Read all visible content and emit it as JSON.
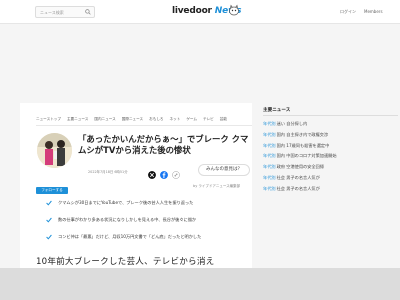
{
  "header": {
    "search_placeholder": "ニュース検索",
    "logo_main": "livedoor",
    "logo_news": "News",
    "login_label": "ログイン",
    "member_label": "Members"
  },
  "category_nav": [
    "ニューストップ",
    "主要ニュース",
    "国内ニュース",
    "国際ニュース",
    "おもしろ",
    "ネット",
    "ゲーム",
    "テレビ",
    "芸能"
  ],
  "article": {
    "title": "「あったかいんだからぁ〜」でブレーク クマムシがTVから消えた後の惨状",
    "date": "2022年7月18日 6時51分",
    "comment_button": "みんなの意見は？",
    "credit": "by ライブドアニュース編集部",
    "follow_label": "フォローする",
    "summary": [
      "クマムシが30日までにYouTubeで、ブレーク後の芸人人生を振り返った",
      "数の仕事がわかり多ある状況になりしかしを見える中、長谷が後々に描か",
      "コンビ仲は「最悪」だけど、月収10万円文書で「どん底」だったと明かした"
    ],
    "headline": "10年前大ブレークした芸人、テレビから消え"
  },
  "sidebar": {
    "title": "主要ニュース",
    "items": [
      {
        "cat": "年代別",
        "text": "迷い 自分探し内"
      },
      {
        "cat": "年代別",
        "text": "国内 自主探き内で政権交渉"
      },
      {
        "cat": "年代別",
        "text": "国内 17歳同も殺害を選定中"
      },
      {
        "cat": "年代別",
        "text": "国内 中国のコロナ対策加速開始"
      },
      {
        "cat": "年代別",
        "text": "政府 空港使用の安全回帰"
      },
      {
        "cat": "年代別",
        "text": "社会 男子の名言人気が"
      },
      {
        "cat": "年代別",
        "text": "社会 男子の名言人気が"
      }
    ]
  },
  "colors": {
    "accent": "#1e90d8",
    "twitter": "#1da1f2",
    "facebook": "#1877f2"
  }
}
